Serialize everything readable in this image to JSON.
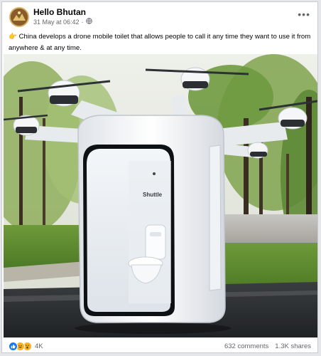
{
  "post": {
    "page_name": "Hello Bhutan",
    "timestamp": "31 May at 06:42",
    "privacy": "·",
    "caption": "China develops a drone mobile toilet that allows people to call it any time they want to use it from anywhere & at any time.",
    "caption_emoji": "👉",
    "more_icon": "•••"
  },
  "photo": {
    "booth_label": "Shuttle"
  },
  "footer": {
    "reaction_count": "4K",
    "comments": "632 comments",
    "shares": "1.3K shares"
  },
  "colors": {
    "facebook_blue": "#1877f2",
    "secondary_text": "#65676b"
  }
}
